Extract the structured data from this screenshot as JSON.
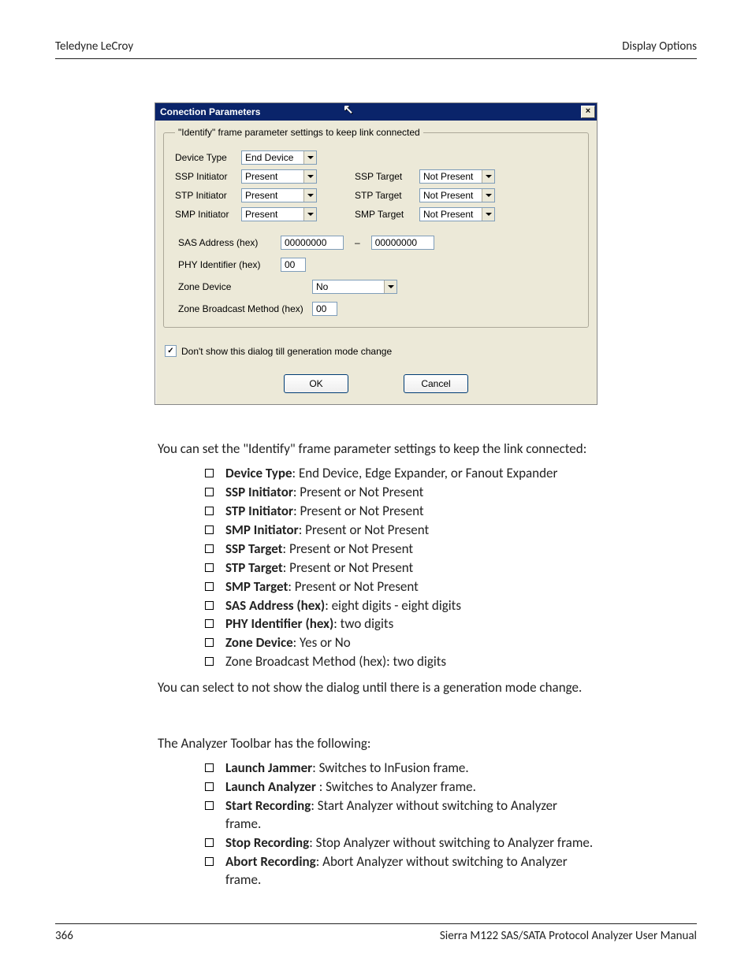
{
  "header": {
    "left": "Teledyne LeCroy",
    "right": "Display Options"
  },
  "dialog": {
    "title": "Conection Parameters",
    "group_legend": "\"Identify\" frame parameter settings to keep link connected",
    "fields": {
      "device_type": {
        "label": "Device Type",
        "value": "End Device"
      },
      "ssp_initiator": {
        "label": "SSP Initiator",
        "value": "Present"
      },
      "stp_initiator": {
        "label": "STP Initiator",
        "value": "Present"
      },
      "smp_initiator": {
        "label": "SMP Initiator",
        "value": "Present"
      },
      "ssp_target": {
        "label": "SSP Target",
        "value": "Not Present"
      },
      "stp_target": {
        "label": "STP Target",
        "value": "Not Present"
      },
      "smp_target": {
        "label": "SMP Target",
        "value": "Not Present"
      },
      "sas_addr": {
        "label": "SAS Address (hex)",
        "v1": "00000000",
        "v2": "00000000"
      },
      "phy_id": {
        "label": "PHY Identifier (hex)",
        "value": "00"
      },
      "zone_device": {
        "label": "Zone Device",
        "value": "No"
      },
      "zone_bcast": {
        "label": "Zone Broadcast Method (hex)",
        "value": "00"
      }
    },
    "checkbox": {
      "label": "Don't show this dialog till generation mode change",
      "checked": "✓"
    },
    "buttons": {
      "ok": "OK",
      "cancel": "Cancel"
    }
  },
  "prose": {
    "p1": "You can set the \"Identify\" frame parameter settings to keep the link connected:",
    "list1": [
      {
        "b": "Device Type",
        "t": ": End Device, Edge Expander, or Fanout Expander"
      },
      {
        "b": "SSP Initiator",
        "t": ": Present or Not Present"
      },
      {
        "b": "STP Initiator",
        "t": ": Present or Not Present"
      },
      {
        "b": "SMP Initiator",
        "t": ": Present or Not Present"
      },
      {
        "b": "SSP Target",
        "t": ": Present or Not Present"
      },
      {
        "b": "STP Target",
        "t": ": Present or Not Present"
      },
      {
        "b": "SMP Target",
        "t": ": Present or Not Present"
      },
      {
        "b": "SAS Address (hex)",
        "t": ": eight digits - eight digits"
      },
      {
        "b": "PHY Identifier (hex)",
        "t": ": two digits"
      },
      {
        "b": "Zone Device",
        "t": ": Yes or No"
      },
      {
        "b": "",
        "t": "Zone Broadcast Method (hex): two digits"
      }
    ],
    "p2": "You can select to not show the dialog until there is a generation mode change.",
    "p3": "The Analyzer Toolbar has the following:",
    "list2": [
      {
        "b": "Launch Jammer",
        "t": ": Switches to InFusion frame."
      },
      {
        "b": "Launch Analyzer ",
        "t": ": Switches to Analyzer frame."
      },
      {
        "b": "Start Recording",
        "t": ": Start Analyzer without switching to Analyzer frame."
      },
      {
        "b": "Stop Recording",
        "t": ": Stop Analyzer without switching to Analyzer frame."
      },
      {
        "b": "Abort Recording",
        "t": ": Abort Analyzer without switching to Analyzer frame."
      }
    ]
  },
  "footer": {
    "page": "366",
    "manual": "Sierra M122 SAS/SATA Protocol Analyzer User Manual"
  }
}
